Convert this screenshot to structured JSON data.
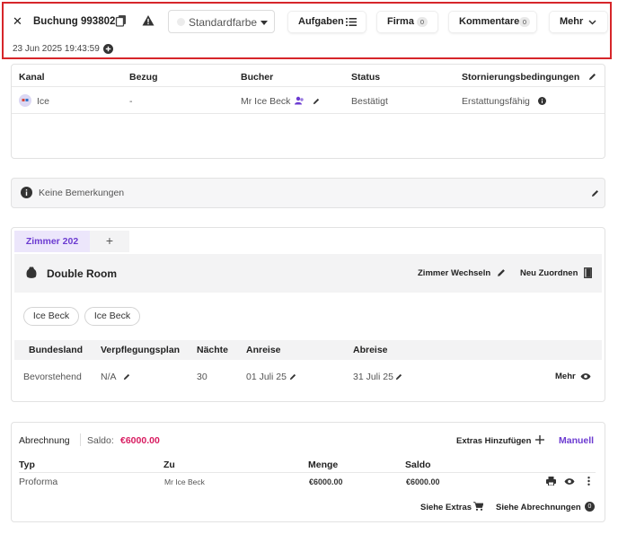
{
  "header": {
    "title": "Buchung 993802",
    "color_label": "Standardfarbe",
    "date": "23 Jun 2025 19:43:59",
    "buttons": [
      {
        "label": "Aufgaben"
      },
      {
        "label": "Firma",
        "count": "0"
      },
      {
        "label": "Kommentare",
        "count": "0"
      },
      {
        "label": "Mehr"
      }
    ]
  },
  "booking_table": {
    "headers": [
      "Kanal",
      "Bezug",
      "Bucher",
      "Status",
      "Stornierungsbedingungen"
    ],
    "row": {
      "kanal": "Ice",
      "bezug": "-",
      "bucher": "Mr Ice Beck",
      "status": "Bestätigt",
      "storno": "Erstattungsfähig"
    }
  },
  "notes": {
    "text": "Keine Bemerkungen"
  },
  "room": {
    "tab_label": "Zimmer 202",
    "tab_add": "+",
    "name": "Double Room",
    "change_label": "Zimmer Wechseln",
    "reassign_label": "Neu Zuordnen",
    "guests": [
      "Ice Beck",
      "Ice Beck"
    ],
    "headers": [
      "Bundesland",
      "Verpflegungsplan",
      "Nächte",
      "Anreise",
      "Abreise"
    ],
    "row": {
      "state": "Bevorstehend",
      "plan": "N/A",
      "nights": "30",
      "arrival": "01 Juli 25",
      "departure": "31 Juli 25"
    },
    "more_label": "Mehr"
  },
  "billing": {
    "title": "Abrechnung",
    "balance_label": "Saldo:",
    "balance_value": "€6000.00",
    "add_extras": "Extras Hinzufügen",
    "manual": "Manuell",
    "headers": [
      "Typ",
      "Zu",
      "Menge",
      "Saldo"
    ],
    "row": {
      "type": "Proforma",
      "to": "Mr Ice Beck",
      "amount": "€6000.00",
      "saldo": "€6000.00"
    },
    "see_extras": "Siehe Extras",
    "see_invoices": "Siehe Abrechnungen",
    "invoice_count": "0"
  },
  "colors": {
    "accent": "#6c3bd1",
    "balance": "#d81b60",
    "highlight_border": "#d6262a"
  }
}
